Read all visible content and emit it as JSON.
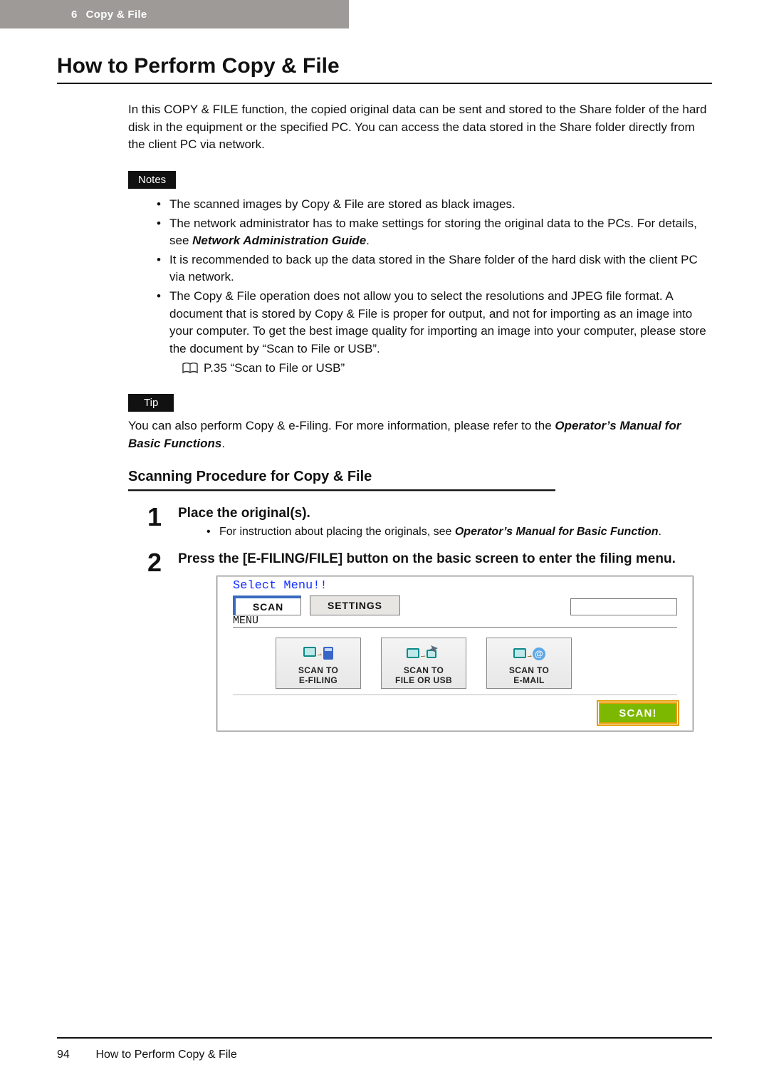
{
  "header": {
    "chapter_num": "6",
    "chapter_title": "Copy & File"
  },
  "title": "How to Perform Copy & File",
  "intro": "In this COPY & FILE function, the copied original data can be sent and stored to the Share folder of the hard disk in the equipment or the specified PC. You can access the data stored in the Share folder directly from the client PC via network.",
  "notes_label": "Notes",
  "notes": [
    {
      "text": "The scanned images by Copy & File are stored as black images."
    },
    {
      "text_before": "The network administrator has to make settings for storing the original data to the PCs. For details, see ",
      "emph": "Network Administration Guide",
      "text_after": "."
    },
    {
      "text": "It is recommended to back up the data stored in the Share folder of the hard disk with the client PC via network."
    },
    {
      "text": "The Copy & File operation does not allow you to select the resolutions and JPEG file format. A document that is stored by Copy & File is proper for output, and not for importing as an image into your computer.  To get the best image quality for importing an image into your computer, please store the document by “Scan to File or USB”.",
      "ref": "P.35 “Scan to File or USB”"
    }
  ],
  "tip_label": "Tip",
  "tip": {
    "text_before": "You can also perform Copy & e-Filing.  For more information, please refer to the ",
    "emph": "Operator’s Manual for Basic Functions",
    "text_after": "."
  },
  "subheading": "Scanning Procedure for Copy & File",
  "steps": [
    {
      "num": "1",
      "title": "Place the original(s).",
      "bullets": [
        {
          "text_before": "For instruction about placing the originals, see ",
          "emph": "Operator’s Manual for Basic Function",
          "text_after": "."
        }
      ]
    },
    {
      "num": "2",
      "title": "Press the [E-FILING/FILE] button on the basic screen to enter the filing menu."
    }
  ],
  "device": {
    "prompt": "Select Menu!!",
    "menu_label": "MENU",
    "tabs": {
      "scan": "SCAN",
      "settings": "SETTINGS"
    },
    "icons": {
      "efiling": {
        "l1": "SCAN TO",
        "l2": "E-FILING"
      },
      "file": {
        "l1": "SCAN TO",
        "l2": "FILE OR USB"
      },
      "email": {
        "l1": "SCAN TO",
        "l2": "E-MAIL"
      }
    },
    "scan_button": "SCAN!"
  },
  "footer": {
    "page_num": "94",
    "title": "How to Perform Copy & File"
  }
}
